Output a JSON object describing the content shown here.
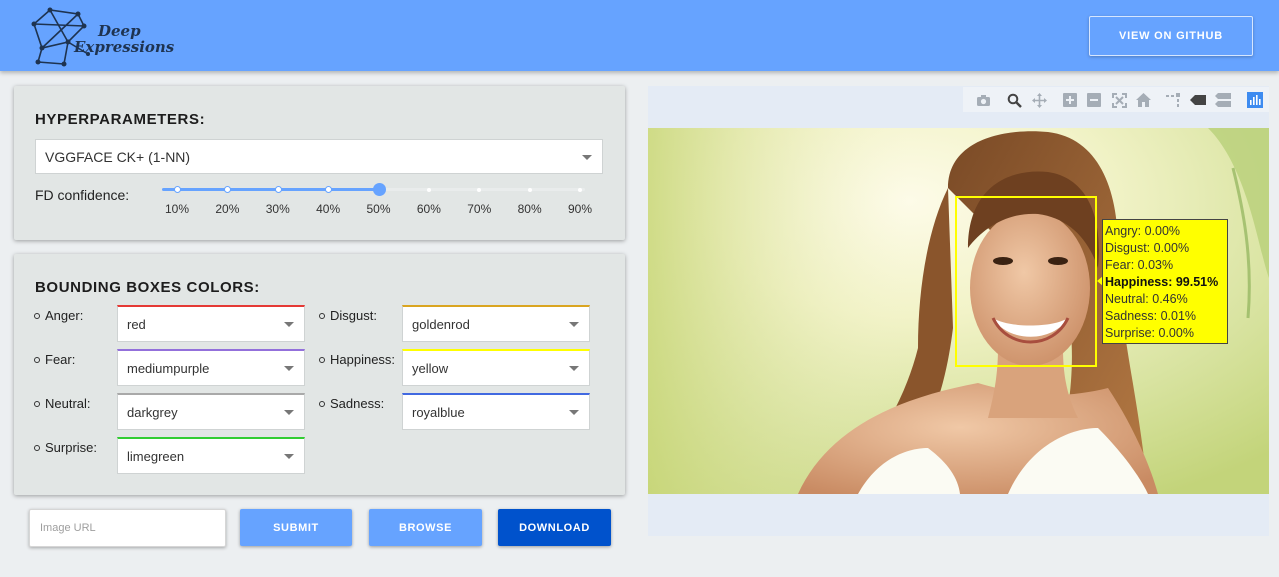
{
  "header": {
    "logo_line1": "Deep",
    "logo_line2": "Expressions",
    "github_button": "VIEW ON GITHUB"
  },
  "hyperparameters": {
    "title": "HYPERPARAMETERS:",
    "model_selected": "VGGFACE CK+ (1-NN)",
    "fd_label": "FD confidence:",
    "fd_ticks": [
      "10%",
      "20%",
      "30%",
      "40%",
      "50%",
      "60%",
      "70%",
      "80%",
      "90%"
    ],
    "fd_value_percent": 50
  },
  "bounding_boxes": {
    "title": "BOUNDING BOXES COLORS:",
    "rows": [
      {
        "label": "Anger:",
        "value": "red",
        "color": "#e53935"
      },
      {
        "label": "Disgust:",
        "value": "goldenrod",
        "color": "#daa520"
      },
      {
        "label": "Fear:",
        "value": "mediumpurple",
        "color": "#9370db"
      },
      {
        "label": "Happiness:",
        "value": "yellow",
        "color": "#ffff00"
      },
      {
        "label": "Neutral:",
        "value": "darkgrey",
        "color": "#a9a9a9"
      },
      {
        "label": "Sadness:",
        "value": "royalblue",
        "color": "#4169e1"
      },
      {
        "label": "Surprise:",
        "value": "limegreen",
        "color": "#32cd32"
      }
    ]
  },
  "actions": {
    "url_placeholder": "Image URL",
    "submit": "SUBMIT",
    "browse": "BROWSE",
    "download": "DOWNLOAD"
  },
  "colors": {
    "accent": "#66a3ff",
    "download": "#0052cc",
    "face_box": "#ffff00"
  },
  "plot": {
    "modebar_icons": [
      "camera-icon",
      "zoom-icon",
      "pan-icon",
      "zoom-in-icon",
      "zoom-out-icon",
      "autoscale-icon",
      "reset-axes-icon",
      "spike-lines-icon",
      "hover-closest-icon",
      "hover-compare-icon",
      "plotly-logo-icon"
    ],
    "emotions": [
      {
        "text": "Angry: 0.00%",
        "bold": false
      },
      {
        "text": "Disgust: 0.00%",
        "bold": false
      },
      {
        "text": "Fear: 0.03%",
        "bold": false
      },
      {
        "text": "Happiness: 99.51%",
        "bold": true
      },
      {
        "text": "Neutral: 0.46%",
        "bold": false
      },
      {
        "text": "Sadness: 0.01%",
        "bold": false
      },
      {
        "text": "Surprise: 0.00%",
        "bold": false
      }
    ]
  }
}
